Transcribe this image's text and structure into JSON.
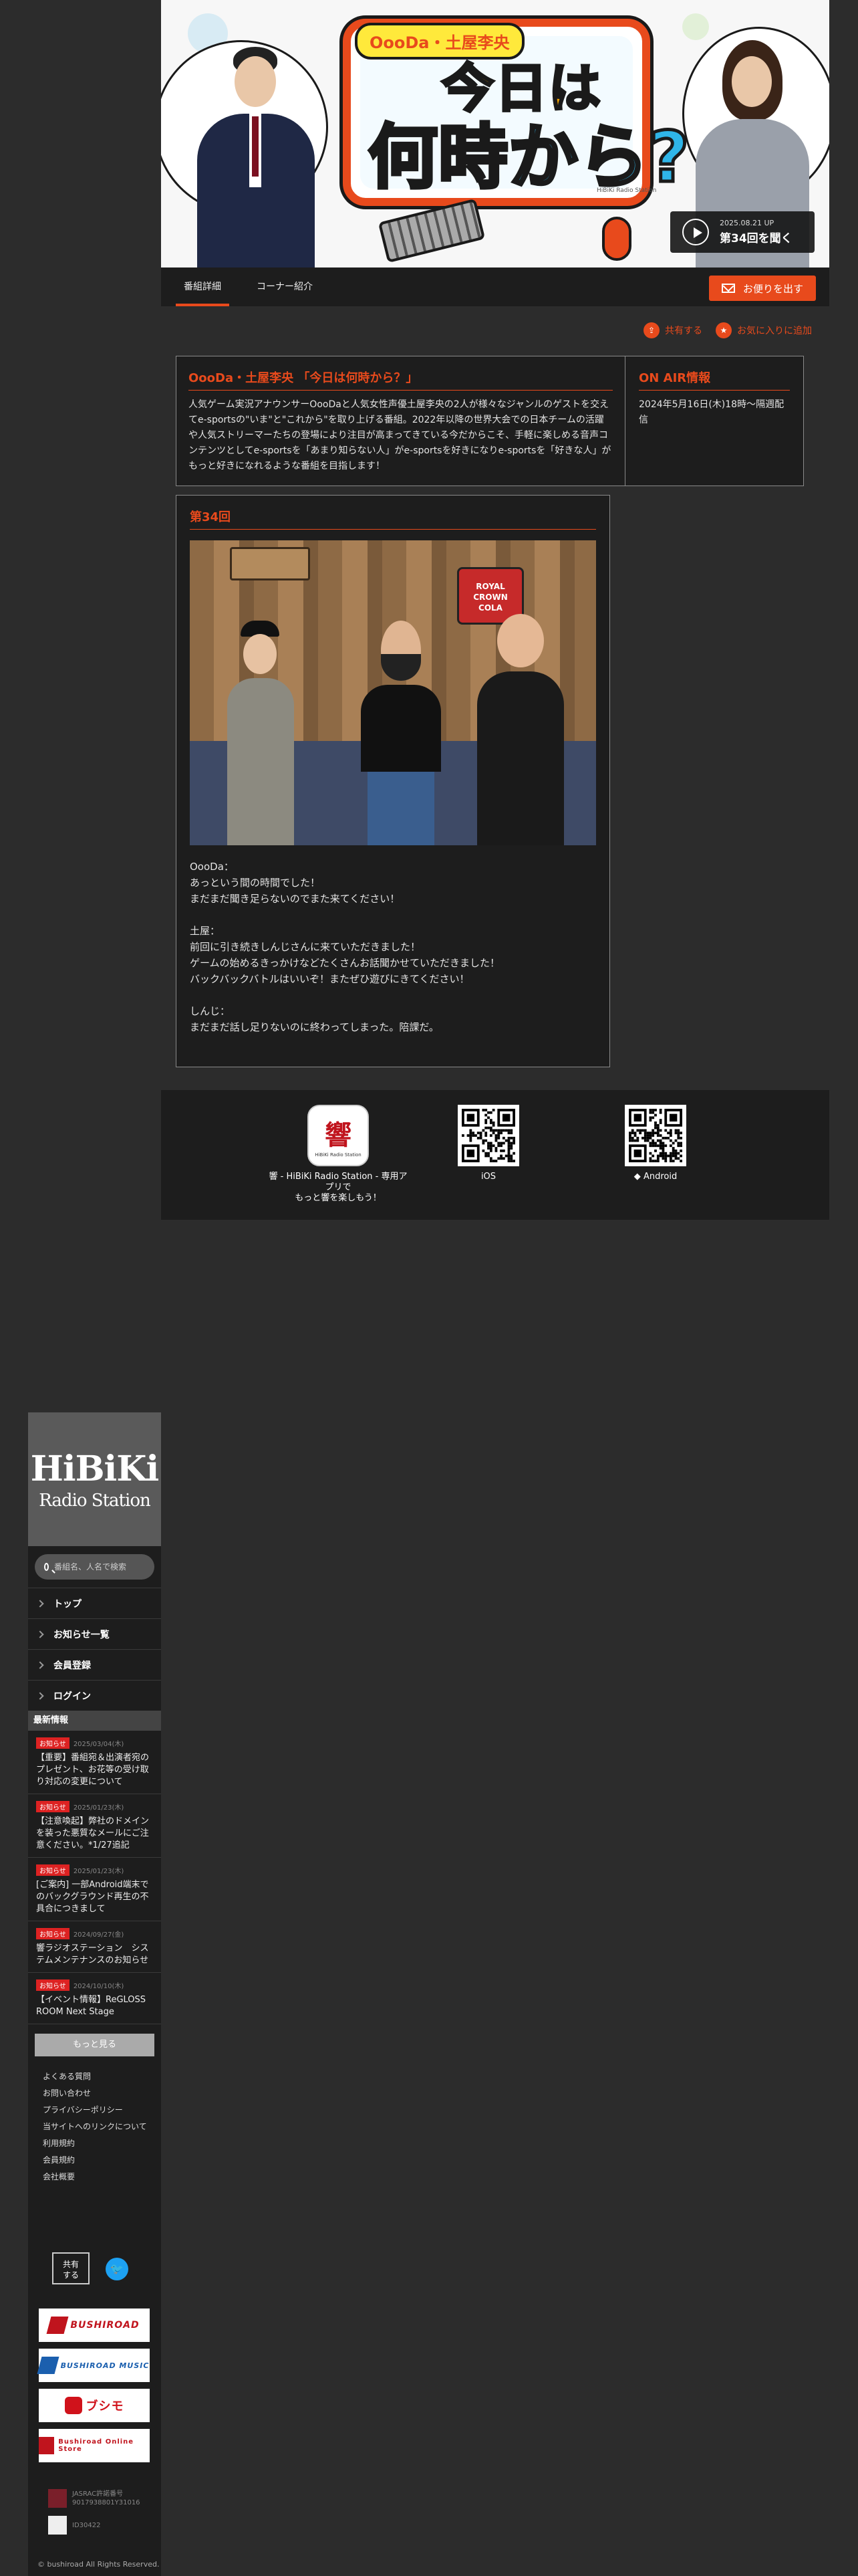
{
  "hero": {
    "logo_top": "OooDa・土屋李央",
    "logo_line1": "今日は",
    "logo_line2": "何時から?",
    "credit": "HiBiKi Radio Station",
    "episode_date": "2025.08.21 UP",
    "episode_label": "第34回を聞く"
  },
  "tabs": [
    {
      "label": "番組詳細"
    },
    {
      "label": "コーナー紹介"
    }
  ],
  "letter_button": "お便りを出す",
  "actions": {
    "share": "共有する",
    "favorite": "お気に入りに追加"
  },
  "description": {
    "title": "OooDa・土屋李央 「今日は何時から？」",
    "body": "人気ゲーム実況アナウンサーOooDaと人気女性声優土屋李央の2人が様々なジャンルのゲストを交えてe-sportsの\"いま\"と\"これから\"を取り上げる番組。2022年以降の世界大会での日本チームの活躍や人気ストリーマーたちの登場により注目が高まってきている今だからこそ、手軽に楽しめる音声コンテンツとしてe-sportsを「あまり知らない人」がe-sportsを好きになりe-sportsを「好きな人」がもっと好きになれるような番組を目指します！"
  },
  "onair": {
    "title": "ON AIR情報",
    "body": "2024年5月16日(木)18時〜隔週配信"
  },
  "episode": {
    "title": "第34回",
    "photo_sign1": "ROYAL CROWN",
    "photo_sign2": "COLA",
    "text": "OooDa：\nあっという間の時間でした！\nまだまだ聞き足らないのでまた来てください！\n\n土屋：\n前回に引き続きしんじさんに来ていただきました！\nゲームの始めるきっかけなどたくさんお話聞かせていただきました！\nバックバックバトルはいいぞ！またぜひ遊びにきてください！\n\nしんじ：\nまだまだ話し足りないのに終わってしまった。陪課だ。"
  },
  "apps": {
    "icon_text": "響",
    "icon_sub": "HiBiKi Radio Station",
    "caption": "響 - HiBiKi Radio Station - 専用アプリで\nもっと響を楽しもう！",
    "ios": "iOS",
    "android": "Android"
  },
  "sidebar": {
    "logo_line1": "HiBiKi",
    "logo_line2": "Radio Station",
    "search_placeholder": "番組名、人名で検索",
    "nav": [
      {
        "label": "トップ"
      },
      {
        "label": "お知らせ一覧"
      },
      {
        "label": "会員登録"
      },
      {
        "label": "ログイン"
      }
    ],
    "news_heading": "最新情報",
    "news": [
      {
        "badge": "お知らせ",
        "date": "2025/03/04(木)",
        "title": "【重要】番組宛＆出演者宛のプレゼント、お花等の受け取り対応の変更について"
      },
      {
        "badge": "お知らせ",
        "date": "2025/01/23(木)",
        "title": "【注意喚起】弊社のドメインを装った悪質なメールにご注意ください。*1/27追記"
      },
      {
        "badge": "お知らせ",
        "date": "2025/01/23(木)",
        "title": "[ご案内] 一部Android端末でのバックグラウンド再生の不具合につきまして"
      },
      {
        "badge": "お知らせ",
        "date": "2024/09/27(金)",
        "title": "響ラジオステーション　システムメンテナンスのお知らせ"
      },
      {
        "badge": "お知らせ",
        "date": "2024/10/10(木)",
        "title": "【イベント情報】ReGLOSS ROOM Next Stage"
      }
    ],
    "more": "もっと見る",
    "links": [
      "よくある質問",
      "お問い合わせ",
      "プライバシーポリシー",
      "当サイトへのリンクについて",
      "利用規約",
      "会員規約",
      "会社概要"
    ],
    "share": "共有\nする",
    "twitter_icon": "twitter-bird-icon",
    "sponsors": [
      {
        "name": "BUSHIROAD",
        "color": "#c0141d"
      },
      {
        "name": "BUSHIROAD MUSIC",
        "color": "#1b5fae"
      },
      {
        "name": "ブシモ",
        "color": "#d0121b"
      },
      {
        "name": "Bushiroad Online Store",
        "color": "#c0141d"
      }
    ],
    "license1": "JASRAC許諾番号\n9017938801Y31016",
    "license2": "ID30422",
    "copyright": "© bushiroad All Rights Reserved."
  },
  "colors": {
    "accent": "#e84a1c",
    "bg": "#2c2c2c",
    "panel": "#1d1d1d",
    "twitter": "#1da1f2"
  }
}
